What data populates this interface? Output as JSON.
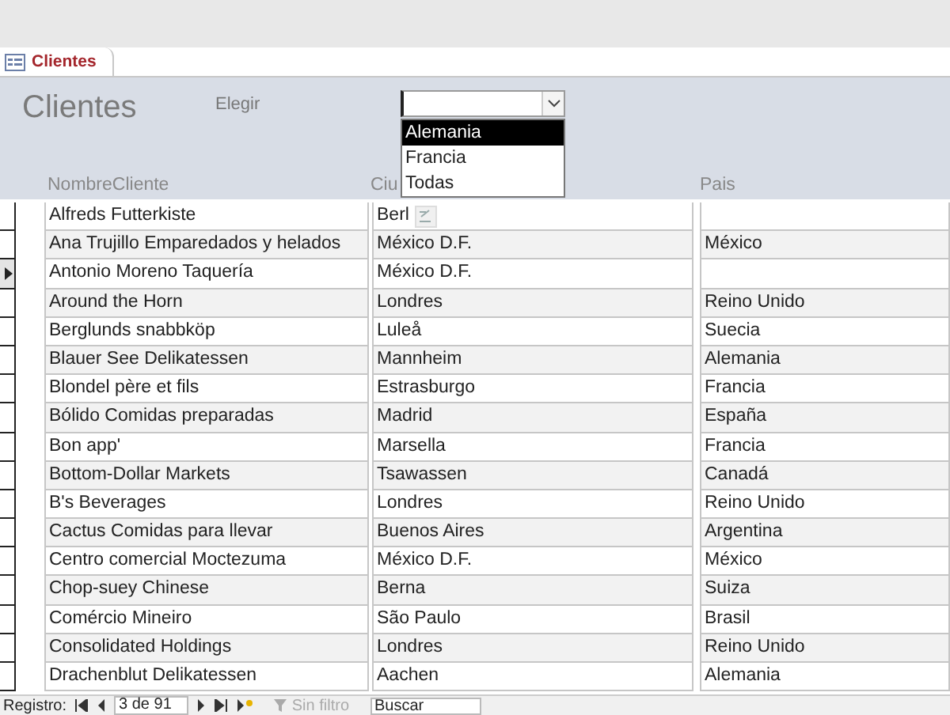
{
  "tab": {
    "label": "Clientes",
    "selected": true
  },
  "form": {
    "title": "Clientes",
    "choose_label": "Elegir",
    "combo": {
      "options": [
        {
          "label": "Alemania",
          "selected": true
        },
        {
          "label": "Francia",
          "selected": false
        },
        {
          "label": "Todas",
          "selected": false
        }
      ]
    }
  },
  "columns": [
    "NombreCliente",
    "Ciu",
    "Pais"
  ],
  "rows": [
    {
      "name": "Alfreds Futterkiste",
      "city": "Berl",
      "selected": false
    },
    {
      "name": "Ana Trujillo Emparedados y helados",
      "city": "México D.F.",
      "country": "México",
      "selected": false
    },
    {
      "name": "Antonio Moreno Taquería",
      "city": "México D.F.",
      "selected": true
    },
    {
      "name": "Around the Horn",
      "city": "Londres",
      "country": "Reino Unido",
      "selected": false
    },
    {
      "name": "Berglunds snabbköp",
      "city": "Luleå",
      "country": "Suecia",
      "selected": false
    },
    {
      "name": "Blauer See Delikatessen",
      "city": "Mannheim",
      "country": "Alemania",
      "selected": false
    },
    {
      "name": "Blondel père et fils",
      "city": "Estrasburgo",
      "country": "Francia",
      "selected": false
    },
    {
      "name": "Bólido Comidas preparadas",
      "city": "Madrid",
      "country": "España",
      "selected": false
    },
    {
      "name": "Bon app'",
      "city": "Marsella",
      "country": "Francia",
      "selected": false
    },
    {
      "name": "Bottom-Dollar Markets",
      "city": "Tsawassen",
      "country": "Canadá",
      "selected": false
    },
    {
      "name": "B's Beverages",
      "city": "Londres",
      "country": "Reino Unido",
      "selected": false
    },
    {
      "name": "Cactus Comidas para llevar",
      "city": "Buenos Aires",
      "country": "Argentina",
      "selected": false
    },
    {
      "name": "Centro comercial Moctezuma",
      "city": "México D.F.",
      "country": "México",
      "selected": false
    },
    {
      "name": "Chop-suey Chinese",
      "city": "Berna",
      "country": "Suiza",
      "selected": false
    },
    {
      "name": "Comércio Mineiro",
      "city": "São Paulo",
      "country": "Brasil",
      "selected": false
    },
    {
      "name": "Consolidated Holdings",
      "city": "Londres",
      "country": "Reino Unido",
      "selected": false
    },
    {
      "name": "Drachenblut Delikatessen",
      "city": "Aachen",
      "country": "Alemania",
      "selected": false
    }
  ],
  "status_bar": {
    "label": "Registro:",
    "position": "3 de 91",
    "filter": {
      "label": "Sin filtro",
      "disabled": true
    },
    "search": {
      "placeholder": "Buscar"
    }
  }
}
